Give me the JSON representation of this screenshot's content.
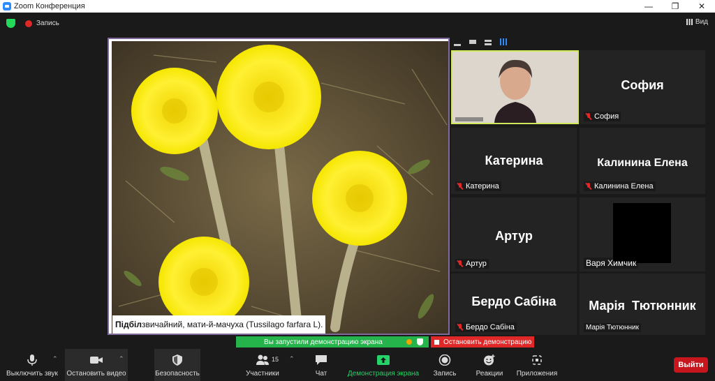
{
  "window": {
    "title": "Zoom Конференция",
    "controls": [
      "—",
      "❐",
      "✕"
    ]
  },
  "topbar": {
    "recording_label": "Запись",
    "view_label": "Вид"
  },
  "shared_screen": {
    "caption_bold": "Підбіл",
    "caption_rest": " звичайний, мати-й-мачуха (Tussilago farfara L)."
  },
  "share_status": {
    "text": "Вы запустили демонстрацию экрана",
    "stop_label": "Остановить демонстрацию"
  },
  "gallery": {
    "tiles": [
      {
        "name": "",
        "label": "",
        "type": "video"
      },
      {
        "name": "София",
        "label": "София",
        "muted": true
      },
      {
        "name": "Катерина",
        "label": "Катерина",
        "muted": true
      },
      {
        "name": "Калинина Елена",
        "label": "Калинина Елена",
        "muted": true
      },
      {
        "name": "Артур",
        "label": "Артур",
        "muted": true
      },
      {
        "name": "",
        "label": "Варя Химчик",
        "muted": false,
        "type": "black"
      },
      {
        "name": "Бердо Сабіна",
        "label": "Бердо Сабіна",
        "muted": true
      },
      {
        "name": "Марія  Тютюнник",
        "label": "Марія Тютюнник",
        "muted": false
      }
    ]
  },
  "toolbar": {
    "mute": "Выключить звук",
    "video": "Остановить видео",
    "security": "Безопасность",
    "participants": "Участники",
    "participants_count": "15",
    "chat": "Чат",
    "share": "Демонстрация экрана",
    "record": "Запись",
    "reactions": "Реакции",
    "apps": "Приложения",
    "leave": "Выйти"
  },
  "colors": {
    "share_green": "#25b34c",
    "stop_red": "#e02828",
    "accent_blue": "#2d8cff",
    "active_speaker": "#cfe95a"
  }
}
